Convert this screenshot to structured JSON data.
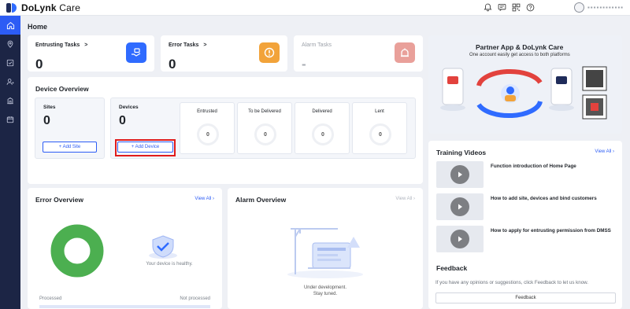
{
  "app": {
    "name_bold": "DoLynk",
    "name_rest": " Care"
  },
  "header": {
    "icons": [
      "bell-icon",
      "message-icon",
      "qrcode-icon",
      "help-icon"
    ],
    "user_name": "▪▪▪▪▪▪▪▪▪▪▪▪"
  },
  "sidebar": {
    "items": [
      "home-icon",
      "location-icon",
      "device-icon",
      "users-icon",
      "building-icon",
      "calendar-icon"
    ]
  },
  "page": {
    "title": "Home"
  },
  "tasks": [
    {
      "title": "Entrusting Tasks",
      "arrow": ">",
      "value": "0",
      "color": "#2f6bff"
    },
    {
      "title": "Error Tasks",
      "arrow": ">",
      "value": "0",
      "color": "#f2a33a"
    },
    {
      "title": "Alarm Tasks",
      "arrow": "",
      "value": "-",
      "color": "#e9a09a"
    }
  ],
  "device_overview": {
    "title": "Device Overview",
    "sites": {
      "label": "Sites",
      "value": "0",
      "button": "+ Add Site"
    },
    "devices": {
      "label": "Devices",
      "value": "0",
      "button": "+ Add Device"
    },
    "stats": [
      {
        "label": "Entrusted",
        "value": "0"
      },
      {
        "label": "To be Delivered",
        "value": "0"
      },
      {
        "label": "Delivered",
        "value": "0"
      },
      {
        "label": "Lent",
        "value": "0"
      }
    ]
  },
  "banner": {
    "title": "Partner App  & DoLynk Care",
    "subtitle": "One account easily get access to both platforms"
  },
  "training": {
    "title": "Training Videos",
    "view_all": "View All ›",
    "videos": [
      {
        "title": "Function introduction of Home Page"
      },
      {
        "title": "How to add site, devices and bind customers"
      },
      {
        "title": "How to apply for entrusting permission from DMSS"
      }
    ]
  },
  "error_overview": {
    "title": "Error Overview",
    "view_all": "View All ›",
    "healthy_text": "Your device is healthy.",
    "processed": "Processed",
    "not_processed": "Not processed",
    "processed_ratio": 1,
    "donut_color": "#4caf50"
  },
  "alarm_overview": {
    "title": "Alarm Overview",
    "view_all": "View All ›",
    "message_1": "Under development.",
    "message_2": "Stay tuned."
  },
  "feedback": {
    "title": "Feedback",
    "text": "If you have any opinions or suggestions, click Feedback to let us know.",
    "button": "Feedback"
  }
}
